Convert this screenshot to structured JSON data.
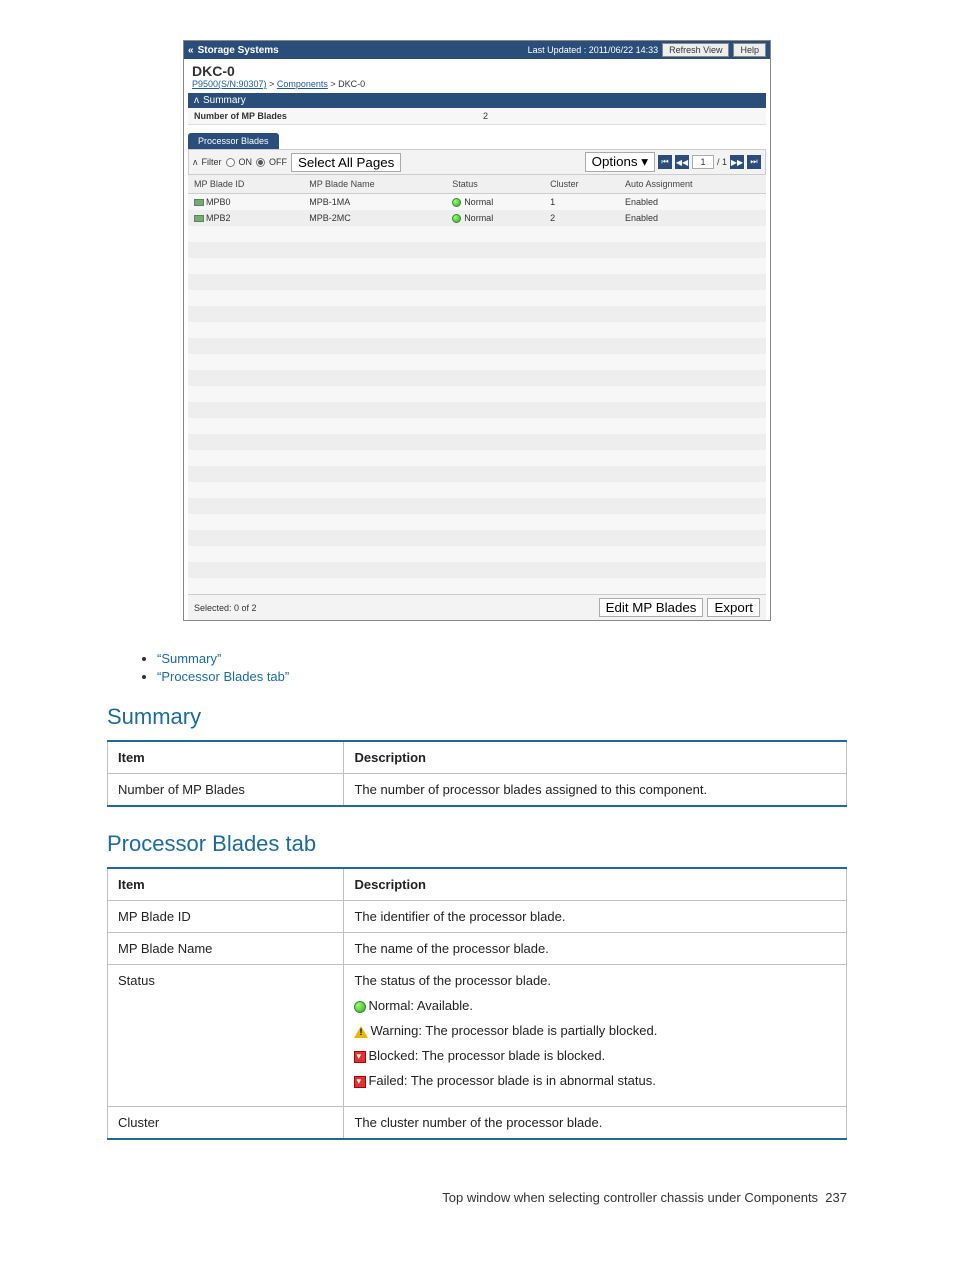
{
  "screenshot": {
    "topbar": {
      "title": "Storage Systems",
      "last_updated_label": "Last Updated : 2011/06/22 14:33",
      "refresh_btn": "Refresh View",
      "help_btn": "Help"
    },
    "page_title": "DKC-0",
    "breadcrumb": {
      "link1": "P9500(S/N:90307)",
      "link2": "Components",
      "current": "DKC-0"
    },
    "summary_section": {
      "heading": "Summary",
      "row_label": "Number of MP Blades",
      "row_value": "2"
    },
    "tab_label": "Processor Blades",
    "toolbar": {
      "filter_label": "Filter",
      "on_label": "ON",
      "off_label": "OFF",
      "select_all": "Select All Pages",
      "options_label": "Options",
      "page_current": "1",
      "page_total": "/ 1"
    },
    "table": {
      "headers": {
        "id": "MP Blade ID",
        "name": "MP Blade Name",
        "status": "Status",
        "cluster": "Cluster",
        "auto": "Auto Assignment"
      },
      "rows": [
        {
          "id": "MPB0",
          "name": "MPB-1MA",
          "status": "Normal",
          "cluster": "1",
          "auto": "Enabled"
        },
        {
          "id": "MPB2",
          "name": "MPB-2MC",
          "status": "Normal",
          "cluster": "2",
          "auto": "Enabled"
        }
      ]
    },
    "footer": {
      "selected": "Selected:  0   of  2",
      "edit_btn": "Edit MP Blades",
      "export_btn": "Export"
    }
  },
  "doc": {
    "bullets": [
      "“Summary”",
      "“Processor Blades tab”"
    ],
    "summary": {
      "heading": "Summary",
      "th_item": "Item",
      "th_desc": "Description",
      "row": {
        "item": "Number of MP Blades",
        "desc": "The number of processor blades assigned to this component."
      }
    },
    "procblades": {
      "heading": "Processor Blades tab",
      "th_item": "Item",
      "th_desc": "Description",
      "rows": {
        "r1": {
          "item": "MP Blade ID",
          "desc": "The identifier of the processor blade."
        },
        "r2": {
          "item": "MP Blade Name",
          "desc": "The name of the processor blade."
        },
        "r3": {
          "item": "Status",
          "desc_intro": "The status of the processor blade.",
          "normal": "Normal: Available.",
          "warning": "Warning: The processor blade is partially blocked.",
          "blocked": "Blocked: The processor blade is blocked.",
          "failed": "Failed: The processor blade is in abnormal status."
        },
        "r4": {
          "item": "Cluster",
          "desc": "The cluster number of the processor blade."
        }
      }
    },
    "footer": {
      "text": "Top window when selecting controller chassis under Components",
      "page": "237"
    }
  }
}
